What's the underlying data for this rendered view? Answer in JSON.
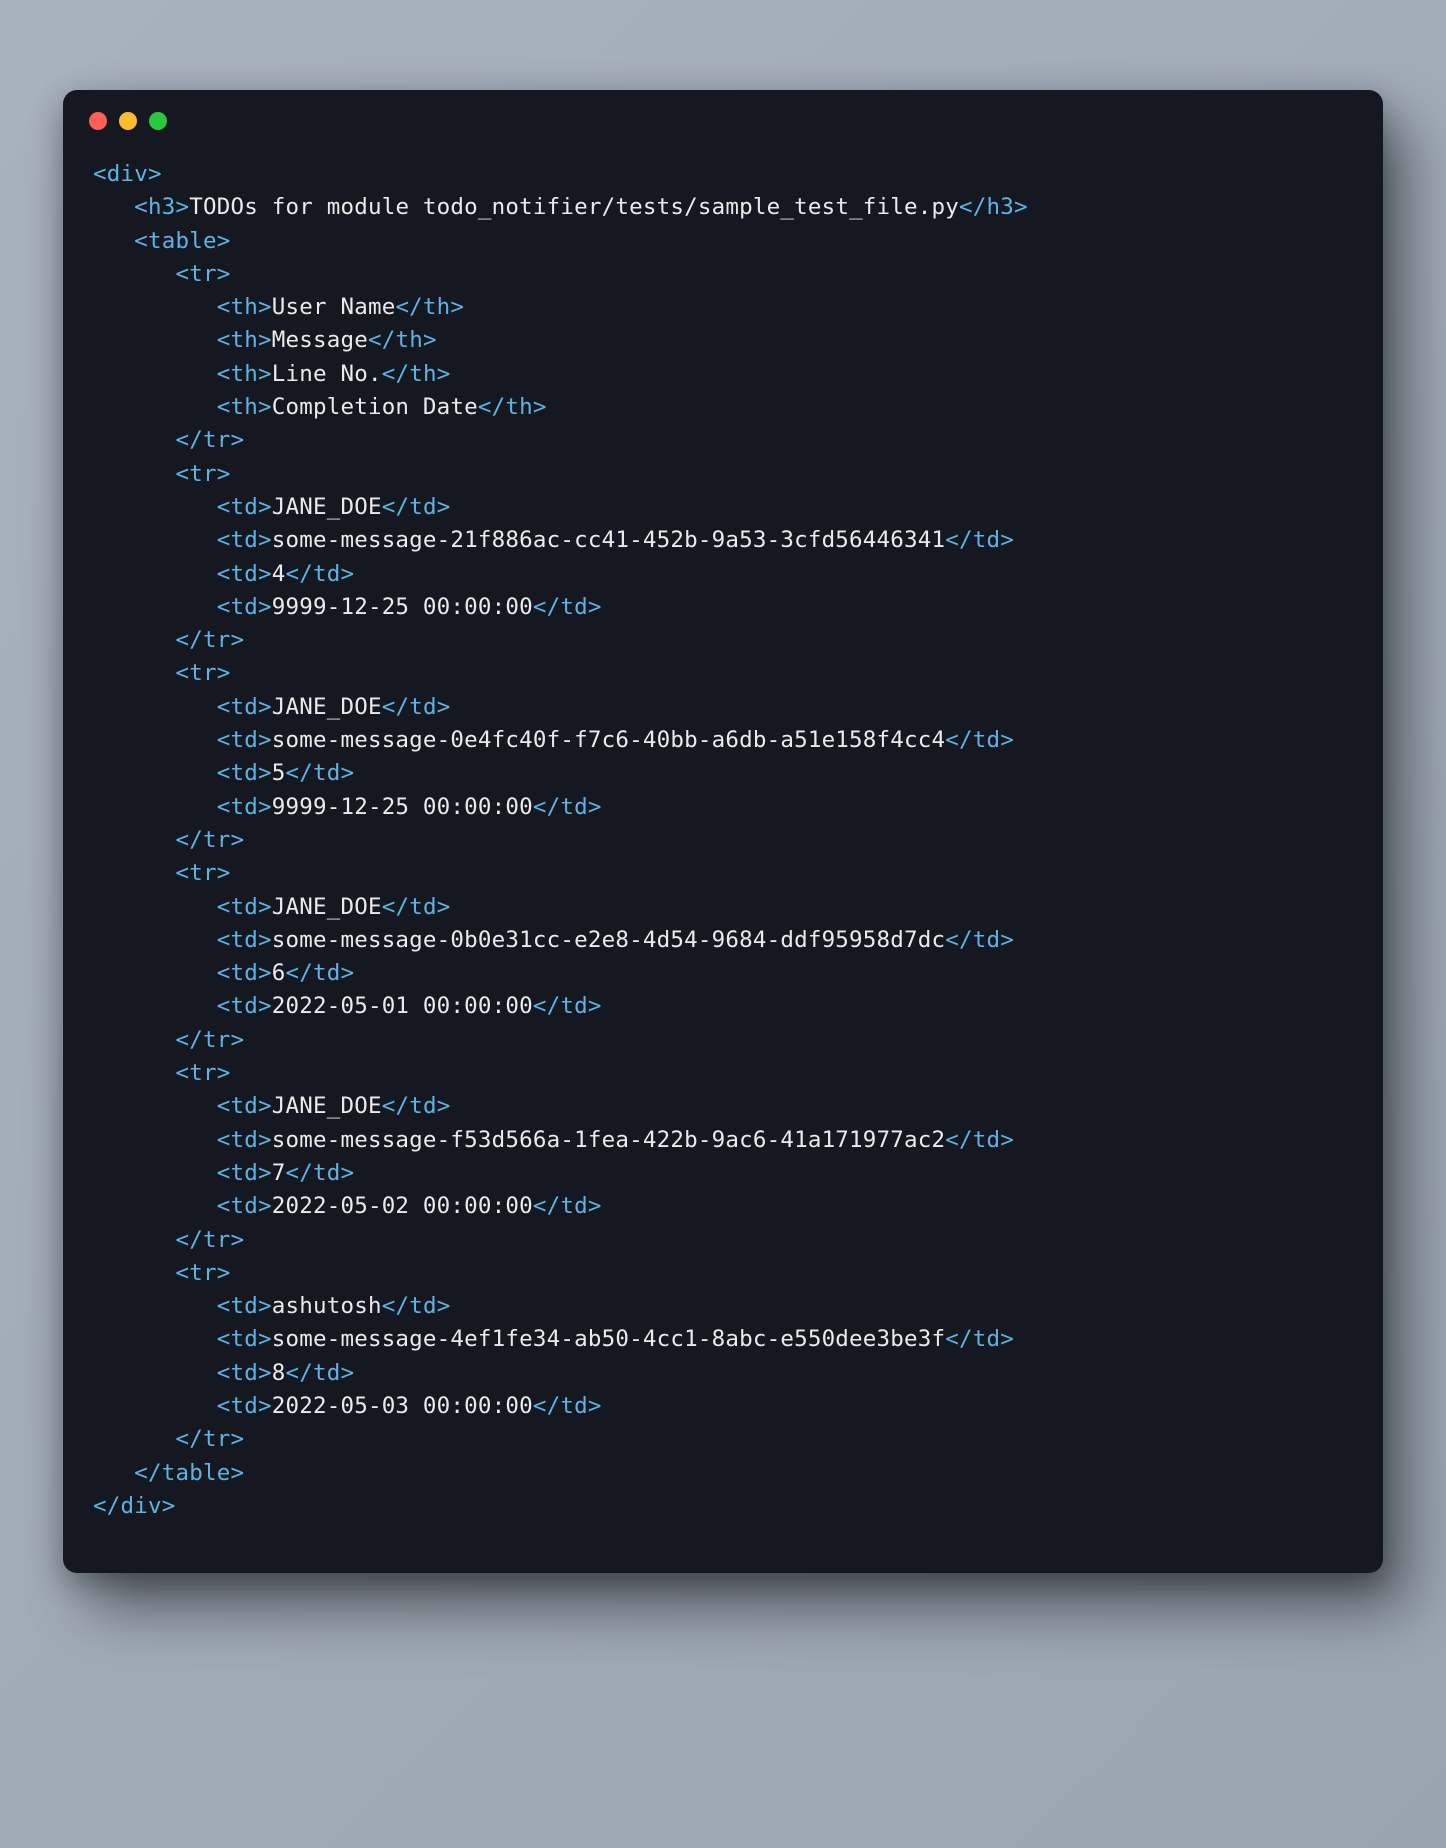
{
  "code": {
    "heading_text": "TODOs for module todo_notifier/tests/sample_test_file.py",
    "headers": [
      "User Name",
      "Message",
      "Line No.",
      "Completion Date"
    ],
    "rows": [
      {
        "user": "JANE_DOE",
        "message": "some-message-21f886ac-cc41-452b-9a53-3cfd56446341",
        "line": "4",
        "date": "9999-12-25 00:00:00"
      },
      {
        "user": "JANE_DOE",
        "message": "some-message-0e4fc40f-f7c6-40bb-a6db-a51e158f4cc4",
        "line": "5",
        "date": "9999-12-25 00:00:00"
      },
      {
        "user": "JANE_DOE",
        "message": "some-message-0b0e31cc-e2e8-4d54-9684-ddf95958d7dc",
        "line": "6",
        "date": "2022-05-01 00:00:00"
      },
      {
        "user": "JANE_DOE",
        "message": "some-message-f53d566a-1fea-422b-9ac6-41a171977ac2",
        "line": "7",
        "date": "2022-05-02 00:00:00"
      },
      {
        "user": "ashutosh",
        "message": "some-message-4ef1fe34-ab50-4cc1-8abc-e550dee3be3f",
        "line": "8",
        "date": "2022-05-03 00:00:00"
      }
    ]
  }
}
